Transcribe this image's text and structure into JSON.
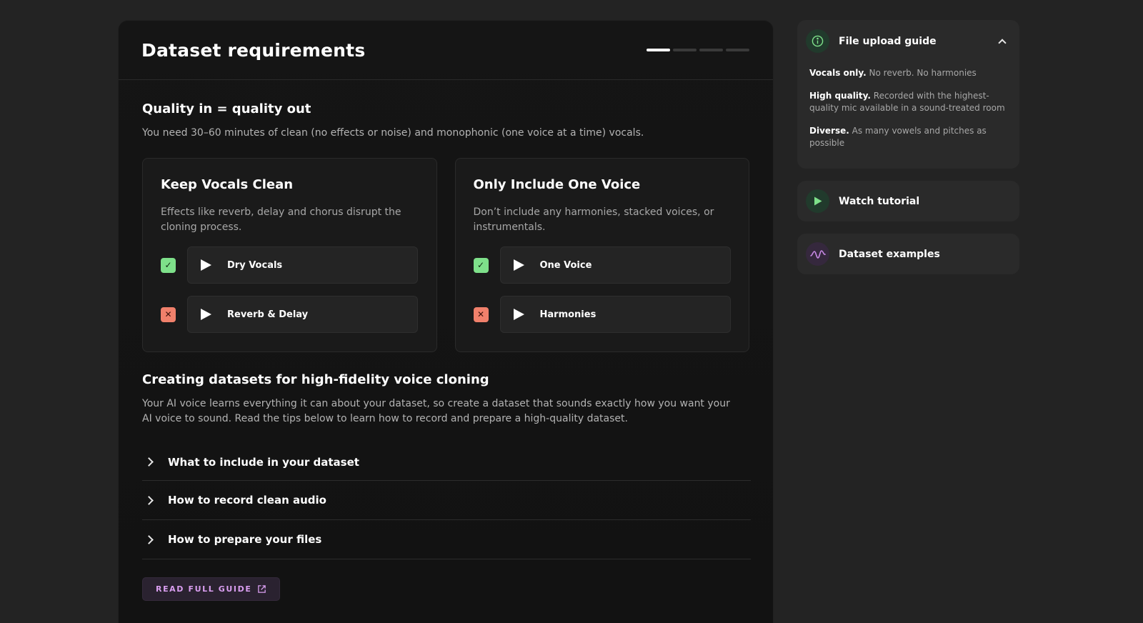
{
  "header": {
    "title": "Dataset requirements"
  },
  "quality": {
    "title": "Quality in = quality out",
    "desc": "You need 30–60 minutes of clean (no effects or noise) and monophonic (one voice at a time) vocals."
  },
  "cards": [
    {
      "title": "Keep Vocals Clean",
      "desc": "Effects like reverb, delay and chorus disrupt the cloning process.",
      "good": "Dry Vocals",
      "bad": "Reverb & Delay"
    },
    {
      "title": "Only Include One Voice",
      "desc": "Don’t include any harmonies, stacked voices, or instrumentals.",
      "good": "One Voice",
      "bad": "Harmonies"
    }
  ],
  "creating": {
    "title": "Creating datasets for high-fidelity voice cloning",
    "desc": "Your AI voice learns everything it can about your dataset, so create a dataset that sounds exactly how you want your AI voice to sound. Read the tips below to learn how to record and prepare a high-quality dataset."
  },
  "accordion": [
    "What to include in your dataset",
    "How to record clean audio",
    "How to prepare your files"
  ],
  "guide_button": "READ FULL GUIDE",
  "sidebar": {
    "upload_guide": {
      "title": "File upload guide",
      "items": [
        {
          "bold": "Vocals only.",
          "text": " No reverb. No harmonies"
        },
        {
          "bold": "High quality.",
          "text": " Recorded with the highest-quality mic available in a sound-treated room"
        },
        {
          "bold": "Diverse.",
          "text": " As many vowels and pitches as possible"
        }
      ]
    },
    "tutorial": "Watch tutorial",
    "examples": "Dataset examples"
  },
  "colors": {
    "ok": "#7ee08a",
    "bad": "#f0806b",
    "accent": "#d99ef0"
  }
}
